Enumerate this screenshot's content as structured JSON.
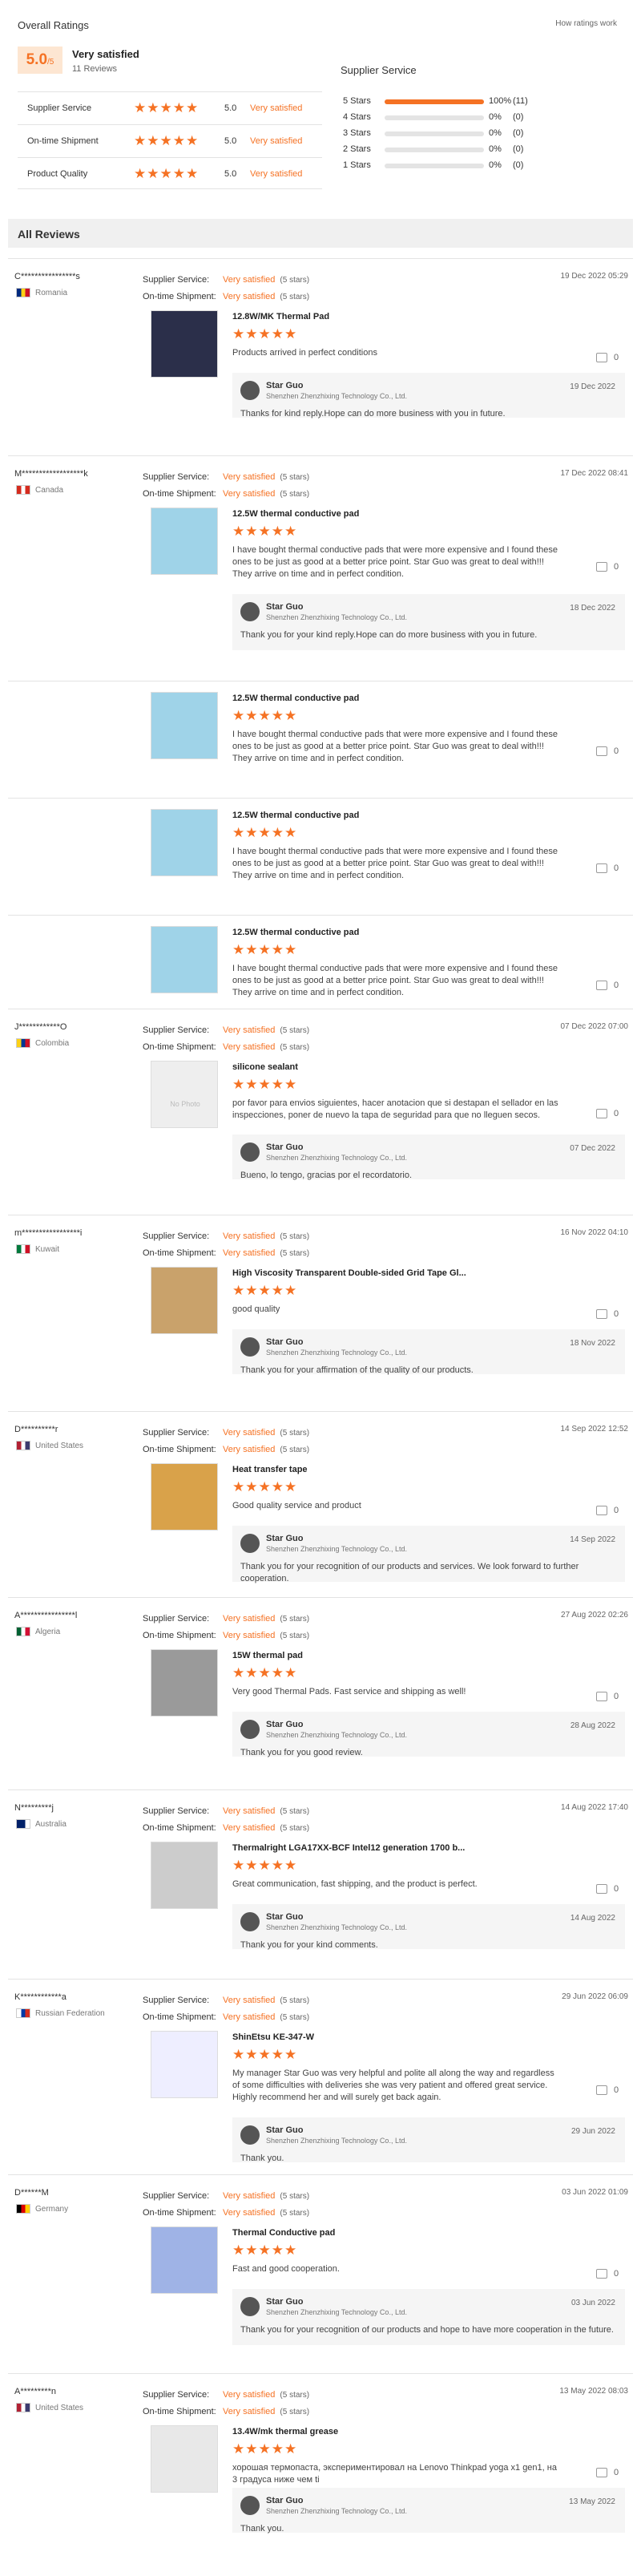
{
  "summary": {
    "title": "Overall Ratings",
    "how_link": "How ratings work",
    "score": "5.0",
    "score_out_of": "/5",
    "overall_label": "Very satisfied",
    "review_count": "11 Reviews",
    "dims": [
      {
        "label": "Supplier Service",
        "stars": "★★★★★",
        "score": "5.0",
        "text": "Very satisfied"
      },
      {
        "label": "On-time Shipment",
        "stars": "★★★★★",
        "score": "5.0",
        "text": "Very satisfied"
      },
      {
        "label": "Product Quality",
        "stars": "★★★★★",
        "score": "5.0",
        "text": "Very satisfied"
      }
    ],
    "supplier_head": "Supplier Service",
    "breakdown": [
      {
        "label": "5 Stars",
        "fraction": 1.0,
        "pct": "100%",
        "count": "(11)"
      },
      {
        "label": "4 Stars",
        "fraction": 0,
        "pct": "0%",
        "count": "(0)"
      },
      {
        "label": "3 Stars",
        "fraction": 0,
        "pct": "0%",
        "count": "(0)"
      },
      {
        "label": "2 Stars",
        "fraction": 0,
        "pct": "0%",
        "count": "(0)"
      },
      {
        "label": "1 Stars",
        "fraction": 0,
        "pct": "0%",
        "count": "(0)"
      }
    ]
  },
  "all_reviews": "All Reviews",
  "labels": {
    "supplier_service": "Supplier Service:",
    "ontime": "On-time Shipment:",
    "very_satisfied": "Very satisfied",
    "five_stars": "(5 stars)",
    "stars": "★★★★★",
    "likes": "0",
    "seller": "Star Guo",
    "company": "Shenzhen Zhenzhixing Technology Co., Ltd."
  },
  "colors": {
    "accent": "#f57224"
  },
  "reviews": [
    {
      "name": "C****************s",
      "country": "Romania",
      "date": "19 Dec 2022 05:29",
      "products": [
        {
          "name": "12.8W/MK Thermal Pad",
          "text": "Products arrived in perfect conditions"
        }
      ],
      "reply": {
        "date": "19 Dec 2022",
        "text": "Thanks for kind reply.Hope can do more business with you in future."
      }
    },
    {
      "name": "M******************k",
      "country": "Canada",
      "date": "17 Dec 2022 08:41",
      "products": [
        {
          "name": "12.5W thermal conductive pad",
          "text": "I have bought thermal conductive pads that were more expensive and I found these ones to be just as good at a better price point. Star Guo was great to deal with!!! They arrive on time and in perfect condition."
        }
      ],
      "reply": {
        "date": "18 Dec 2022",
        "text": "Thank you for your kind reply.Hope can do more business with you in future."
      },
      "extra": [
        {
          "name": "12.5W thermal conductive pad",
          "text": "I have bought thermal conductive pads that were more expensive and I found these ones to be just as good at a better price point. Star Guo was great to deal with!!! They arrive on time and in perfect condition."
        },
        {
          "name": "12.5W thermal conductive pad",
          "text": "I have bought thermal conductive pads that were more expensive and I found these ones to be just as good at a better price point. Star Guo was great to deal with!!! They arrive on time and in perfect condition."
        },
        {
          "name": "12.5W thermal conductive pad",
          "text": "I have bought thermal conductive pads that were more expensive and I found these ones to be just as good at a better price point. Star Guo was great to deal with!!! They arrive on time and in perfect condition."
        }
      ]
    },
    {
      "name": "J************O",
      "country": "Colombia",
      "date": "07 Dec 2022 07:00",
      "products": [
        {
          "name": "silicone sealant",
          "text": "por favor para envios siguientes, hacer anotacion que si destapan el sellador en las inspecciones, poner de nuevo la tapa de seguridad para que no lleguen secos."
        }
      ],
      "nophoto": "No Photo",
      "reply": {
        "date": "07 Dec 2022",
        "text": "Bueno, lo tengo, gracias por el recordatorio."
      }
    },
    {
      "name": "m*****************i",
      "country": "Kuwait",
      "date": "16 Nov 2022 04:10",
      "products": [
        {
          "name": "High Viscosity Transparent Double-sided Grid Tape Gl...",
          "text": "good quality"
        }
      ],
      "reply": {
        "date": "18 Nov 2022",
        "text": "Thank you for your affirmation of the quality of our products."
      }
    },
    {
      "name": "D**********r",
      "country": "United States",
      "date": "14 Sep 2022 12:52",
      "products": [
        {
          "name": "Heat transfer tape",
          "text": "Good quality service and product"
        }
      ],
      "reply": {
        "date": "14 Sep 2022",
        "text": "Thank you for your recognition of our products and services. We look forward to further cooperation."
      }
    },
    {
      "name": "A****************l",
      "country": "Algeria",
      "date": "27 Aug 2022 02:26",
      "products": [
        {
          "name": "15W thermal pad",
          "text": "Very good Thermal Pads. Fast service and shipping as well!"
        }
      ],
      "reply": {
        "date": "28 Aug 2022",
        "text": "Thank you for you good review."
      }
    },
    {
      "name": "N*********j",
      "country": "Australia",
      "date": "14 Aug 2022 17:40",
      "products": [
        {
          "name": "Thermalright LGA17XX-BCF Intel12 generation 1700 b...",
          "text": "Great communication, fast shipping, and the product is perfect."
        }
      ],
      "reply": {
        "date": "14 Aug 2022",
        "text": "Thank you for your kind comments."
      }
    },
    {
      "name": "K************a",
      "country": "Russian Federation",
      "date": "29 Jun 2022 06:09",
      "products": [
        {
          "name": "ShinEtsu KE-347-W",
          "text": "My manager Star Guo was very helpful and polite all along the way and regardless of some difficulties with deliveries she was very patient and offered great service. Highly recommend her and will surely get back again."
        }
      ],
      "reply": {
        "date": "29 Jun 2022",
        "text": "Thank you."
      }
    },
    {
      "name": "D******M",
      "country": "Germany",
      "date": "03 Jun 2022 01:09",
      "products": [
        {
          "name": "Thermal Conductive pad",
          "text": "Fast and good cooperation."
        }
      ],
      "reply": {
        "date": "03 Jun 2022",
        "text": "Thank you for your recognition of our products and hope to have more cooperation in the future."
      }
    },
    {
      "name": "A*********n",
      "country": "United States",
      "date": "13 May 2022 08:03",
      "products": [
        {
          "name": "13.4W/mk thermal grease",
          "text": "хорошая термопаста, экспериментировал на Lenovo Thinkpad yoga x1 gen1, на 3 градуса ниже чем ti"
        }
      ],
      "reply": {
        "date": "13 May 2022",
        "text": "Thank you."
      }
    }
  ]
}
